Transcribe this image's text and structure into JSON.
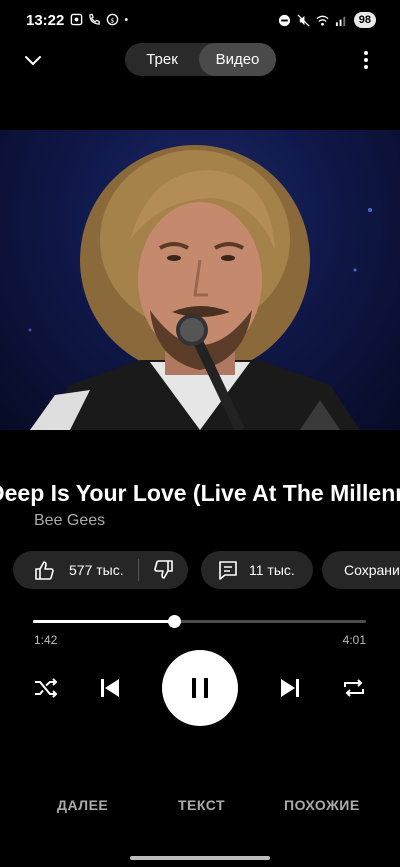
{
  "status_bar": {
    "time": "13:22",
    "battery": "98",
    "icons_left": [
      "screenshot-icon",
      "wifi-calling-icon",
      "payment-icon",
      "dot-icon"
    ],
    "icons_right": [
      "dnd-icon",
      "mute-icon",
      "wifi-icon",
      "signal-icon"
    ]
  },
  "top_bar": {
    "tabs": [
      {
        "label": "Трек",
        "selected": false
      },
      {
        "label": "Видео",
        "selected": true
      }
    ]
  },
  "track": {
    "title": "Deep Is Your Love (Live At The Millennium Concert)",
    "artist": "Bee Gees"
  },
  "actions": {
    "likes": "577 тыс.",
    "comments": "11 тыс.",
    "save": "Сохранить"
  },
  "progress": {
    "elapsed": "1:42",
    "duration": "4:01",
    "fraction": 0.424
  },
  "bottom_tabs": [
    "ДАЛЕЕ",
    "ТЕКСТ",
    "ПОХОЖИЕ"
  ],
  "colors": {
    "background": "#000000",
    "chip": "#262626",
    "toggle": "#2a2a2a",
    "toggle_selected": "#4a4a4a",
    "secondary_text": "#aaaaaa"
  }
}
